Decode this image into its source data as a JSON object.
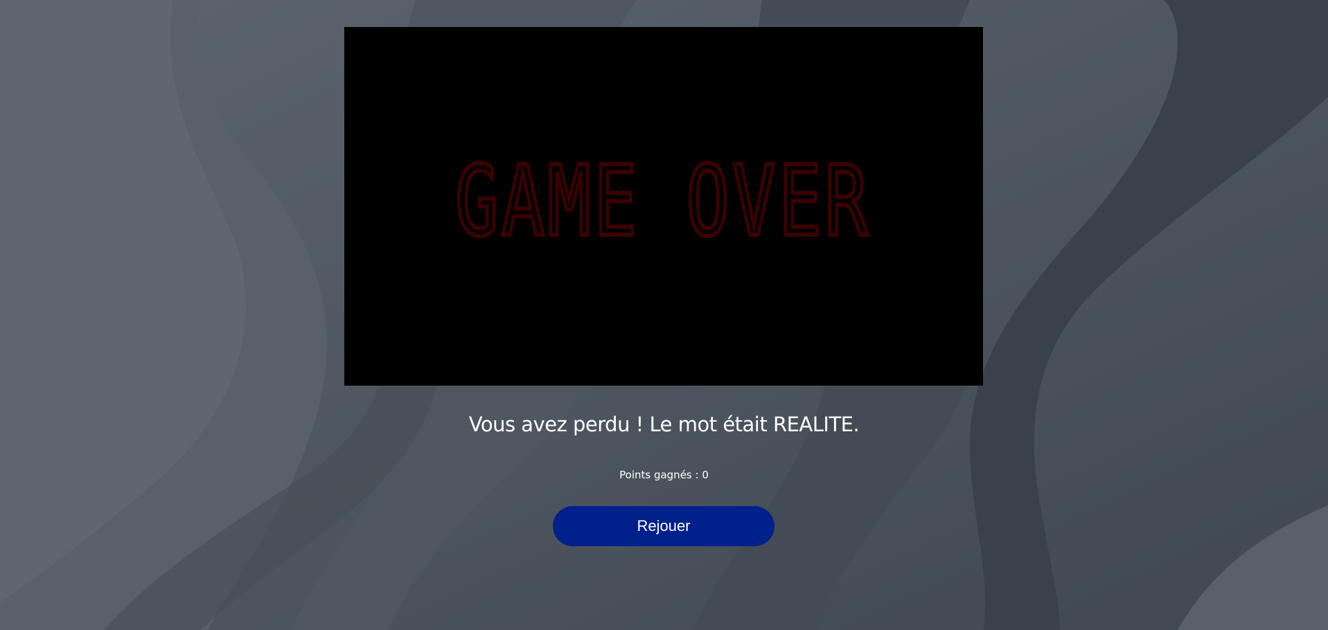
{
  "game": {
    "screen_text": "GAME OVER",
    "screen_background": "#000000",
    "screen_text_color": "#3d0000"
  },
  "result": {
    "message": "Vous avez perdu ! Le mot était REALITE.",
    "points": "Points gagnés : 0"
  },
  "actions": {
    "replay_label": "Rejouer",
    "replay_color": "#00208c"
  }
}
